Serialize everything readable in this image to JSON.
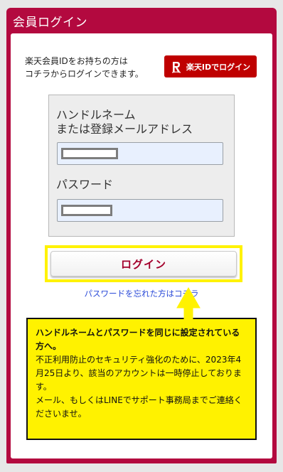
{
  "window": {
    "title": "会員ログイン"
  },
  "intro": {
    "line1": "楽天会員IDをお持ちの方は",
    "line2": "コチラからログインできます。"
  },
  "rakuten_button": {
    "label": "楽天IDでログイン",
    "icon": "rakuten-r-icon"
  },
  "form": {
    "handle_label_line1": "ハンドルネーム",
    "handle_label_line2": "または登録メールアドレス",
    "password_label": "パスワード"
  },
  "login_button": {
    "label": "ログイン"
  },
  "forgot_link": {
    "label": "パスワードを忘れた方はコチラ"
  },
  "notice": {
    "heading": "ハンドルネームとパスワードを同じに設定されている方へ。",
    "body1": "不正利用防止のセキュリティ強化のために、2023年4月25日より、該当のアカウントは一時停止しております。",
    "body2": "メール、もしくはLINEでサポート事務局までご連絡くださいませ。"
  },
  "colors": {
    "frame": "#b3093f",
    "rakuten_red": "#bf0000",
    "highlight_yellow": "#fff200",
    "link_blue": "#2a4ad8"
  }
}
